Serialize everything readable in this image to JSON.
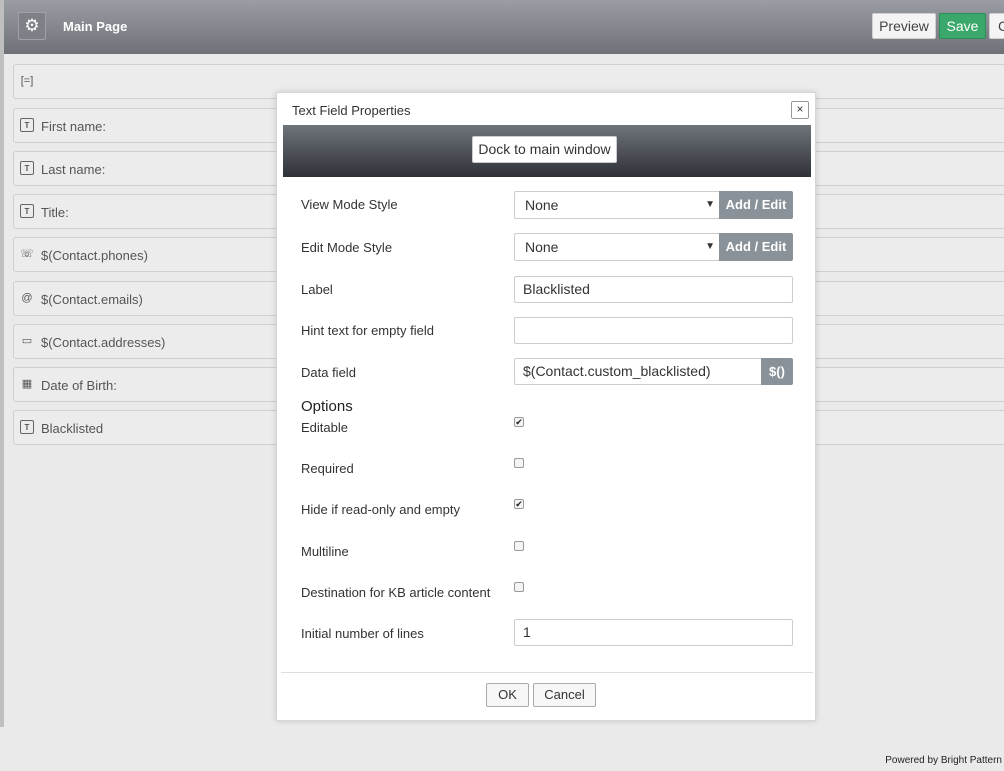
{
  "header": {
    "title": "Main Page",
    "gear_icon": "gear-icon",
    "preview_label": "Preview",
    "save_label": "Save",
    "close_label": "C"
  },
  "canvas": {
    "rows": [
      {
        "icon": "[=]",
        "label": ""
      },
      {
        "icon": "T",
        "label": "First name:"
      },
      {
        "icon": "T",
        "label": "Last name:"
      },
      {
        "icon": "T",
        "label": "Title:"
      },
      {
        "icon": "☏",
        "label": "$(Contact.phones)"
      },
      {
        "icon": "@",
        "label": "$(Contact.emails)"
      },
      {
        "icon": "▭",
        "label": "$(Contact.addresses)"
      },
      {
        "icon": "▦",
        "label": "Date of Birth:"
      },
      {
        "icon": "T",
        "label": "Blacklisted"
      }
    ]
  },
  "dialog": {
    "title": "Text Field Properties",
    "close_icon": "×",
    "dock_label": "Dock to main window",
    "view_mode_label": "View Mode Style",
    "view_mode_value": "None",
    "edit_mode_label": "Edit Mode Style",
    "edit_mode_value": "None",
    "add_edit_label": "Add / Edit",
    "label_label": "Label",
    "label_value": "Blacklisted",
    "hint_label": "Hint text for empty field",
    "hint_value": "",
    "data_field_label": "Data field",
    "data_field_value": "$(Contact.custom_blacklisted)",
    "data_field_btn": "$()",
    "options_heading": "Options",
    "options": [
      {
        "label": "Editable",
        "checked": true
      },
      {
        "label": "Required",
        "checked": false
      },
      {
        "label": "Hide if read-only and empty",
        "checked": true
      },
      {
        "label": "Multiline",
        "checked": false
      },
      {
        "label": "Destination for KB article content",
        "checked": false
      }
    ],
    "lines_label": "Initial number of lines",
    "lines_value": "1",
    "ok_label": "OK",
    "cancel_label": "Cancel"
  },
  "footer": {
    "powered_by": "Powered by Bright Pattern"
  }
}
